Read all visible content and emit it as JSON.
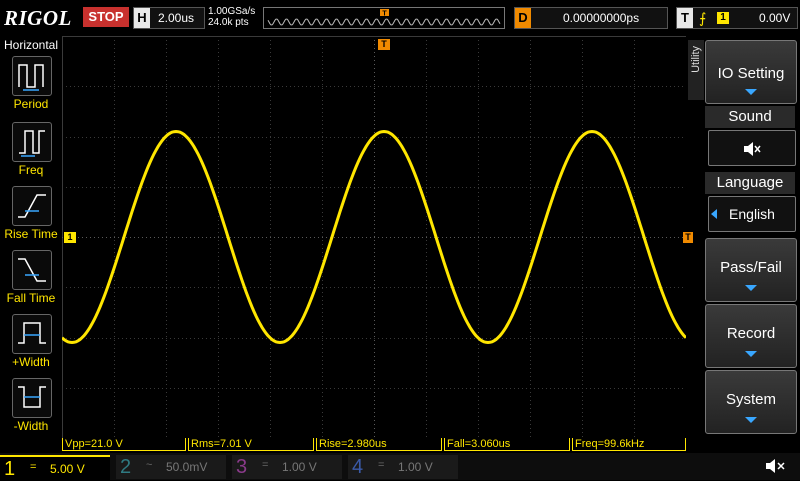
{
  "top": {
    "brand": "RIGOL",
    "run_status": "STOP",
    "timebase": {
      "letter": "H",
      "value": "2.00us"
    },
    "sample_rate": "1.00GSa/s",
    "mem_depth": "24.0k pts",
    "trigger_pos_marker": "T",
    "delay": {
      "letter": "D",
      "value": "0.00000000ps"
    },
    "trigger": {
      "letter": "T",
      "edge": "⨍",
      "source": "1",
      "level": "0.00V"
    }
  },
  "left_panel": {
    "title": "Horizontal",
    "items": [
      {
        "label": "Period",
        "icon": "period-icon"
      },
      {
        "label": "Freq",
        "icon": "frequency-icon"
      },
      {
        "label": "Rise Time",
        "icon": "rise-time-icon"
      },
      {
        "label": "Fall Time",
        "icon": "fall-time-icon"
      },
      {
        "label": "+Width",
        "icon": "positive-width-icon"
      },
      {
        "label": "-Width",
        "icon": "negative-width-icon"
      }
    ]
  },
  "waveform": {
    "channel_marker": "1",
    "trigger_level_marker": "T",
    "top_trigger_marker": "T",
    "color": "#ffe600",
    "period_divisions": 4.0,
    "amplitude_divisions": 2.1,
    "grid_color": "#3a3a3a"
  },
  "right_panel": {
    "tab": "Utility",
    "io_setting": "IO Setting",
    "sound_header": "Sound",
    "sound_icon": "speaker-mute-icon",
    "language_header": "Language",
    "language_value": "English",
    "pass_fail": "Pass/Fail",
    "record": "Record",
    "system": "System"
  },
  "measurements": {
    "vpp": "Vpp=21.0 V",
    "rms": "Rms=7.01 V",
    "rise": "Rise=2.980us",
    "fall": "Fall=3.060us",
    "freq": "Freq=99.6kHz"
  },
  "channels": [
    {
      "num": "1",
      "coupling": "=",
      "scale": "5.00 V",
      "color": "#ffe600",
      "active": true
    },
    {
      "num": "2",
      "coupling": "~",
      "scale": "50.0mV",
      "color": "#00bcd4",
      "active": false
    },
    {
      "num": "3",
      "coupling": "=",
      "scale": "1.00 V",
      "color": "#d63ad6",
      "active": false
    },
    {
      "num": "4",
      "coupling": "=",
      "scale": "1.00 V",
      "color": "#2f6fff",
      "active": false
    }
  ],
  "status_icon": "speaker-mute-icon"
}
